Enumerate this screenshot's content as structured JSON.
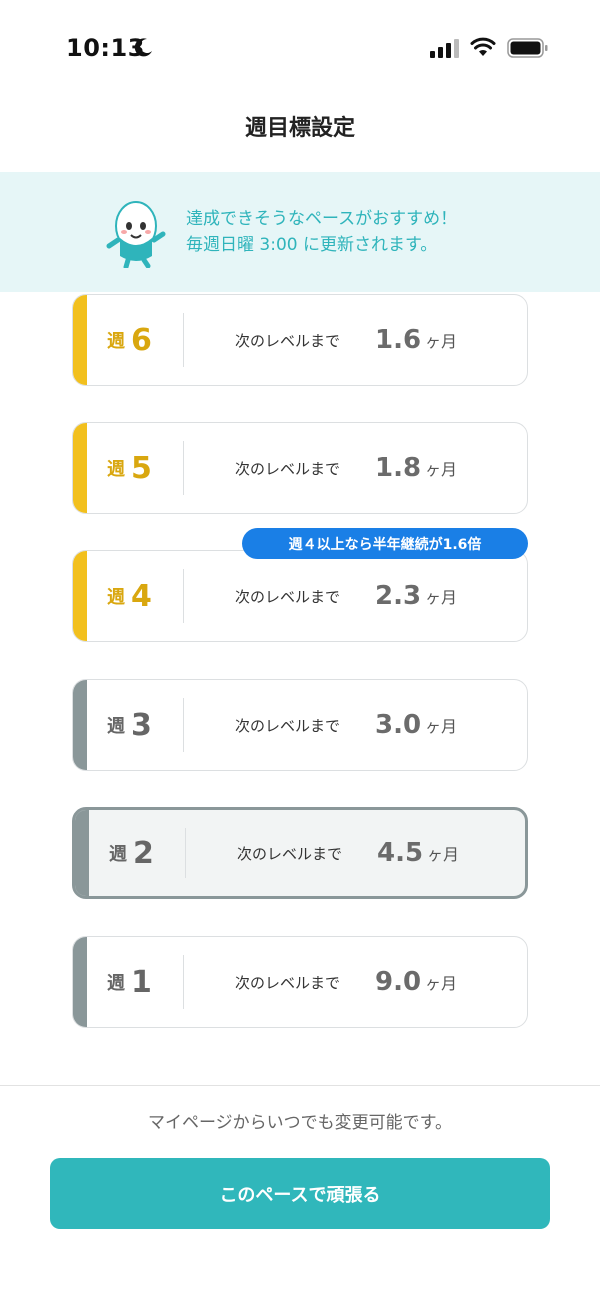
{
  "status_bar": {
    "time": "10:13"
  },
  "header": {
    "title": "週目標設定"
  },
  "banner": {
    "line1": "達成できそうなペースがおすすめ！",
    "line2": "毎週日曜 3:00 に更新されます。"
  },
  "promo_badge": "週４以上なら半年継続が1.6倍",
  "options": [
    {
      "prefix": "週",
      "number": "6",
      "until": "次のレベルまで",
      "value": "1.6",
      "unit": "ヶ月",
      "color": "#f2c01e"
    },
    {
      "prefix": "週",
      "number": "5",
      "until": "次のレベルまで",
      "value": "1.8",
      "unit": "ヶ月",
      "color": "#f2c01e"
    },
    {
      "prefix": "週",
      "number": "4",
      "until": "次のレベルまで",
      "value": "2.3",
      "unit": "ヶ月",
      "color": "#f2c01e"
    },
    {
      "prefix": "週",
      "number": "3",
      "until": "次のレベルまで",
      "value": "3.0",
      "unit": "ヶ月",
      "color": "#8a9799"
    },
    {
      "prefix": "週",
      "number": "2",
      "until": "次のレベルまで",
      "value": "4.5",
      "unit": "ヶ月",
      "color": "#8a9799",
      "selected": true
    },
    {
      "prefix": "週",
      "number": "1",
      "until": "次のレベルまで",
      "value": "9.0",
      "unit": "ヶ月",
      "color": "#8a9799"
    }
  ],
  "footer": {
    "note": "マイページからいつでも変更可能です。",
    "cta_label": "このペースで頑張る"
  },
  "colors": {
    "accent": "#30b7bb",
    "gold": "#f2c01e",
    "gray": "#8a9799",
    "badge": "#1a7fe6"
  }
}
